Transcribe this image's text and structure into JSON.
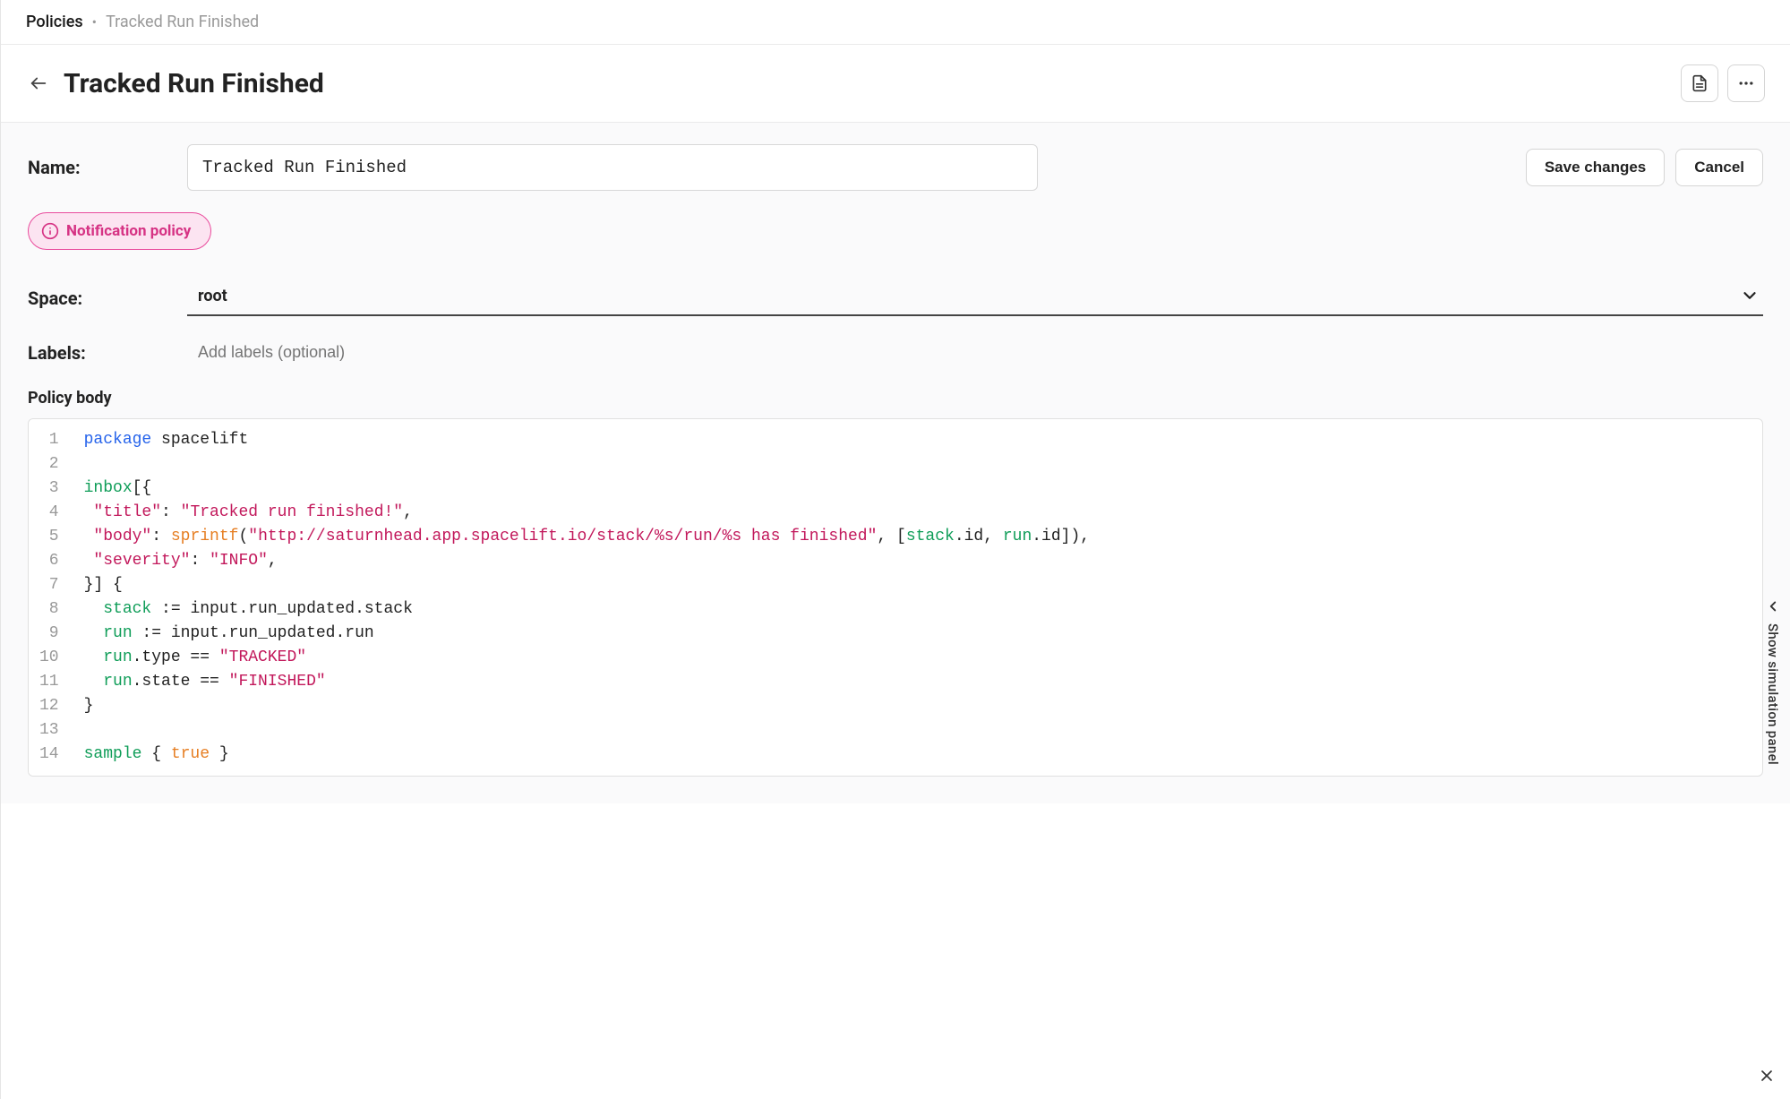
{
  "breadcrumb": {
    "root": "Policies",
    "separator": "•",
    "current": "Tracked Run Finished"
  },
  "header": {
    "title": "Tracked Run Finished"
  },
  "form": {
    "name_label": "Name:",
    "name_value": "Tracked Run Finished",
    "save_label": "Save changes",
    "cancel_label": "Cancel",
    "space_label": "Space:",
    "space_value": "root",
    "labels_label": "Labels:",
    "labels_placeholder": "Add labels (optional)"
  },
  "badge": {
    "text": "Notification policy"
  },
  "policy_body_title": "Policy body",
  "sim_panel_label": "Show simulation panel",
  "code": {
    "line_numbers": [
      "1",
      "2",
      "3",
      "4",
      "5",
      "6",
      "7",
      "8",
      "9",
      "10",
      "11",
      "12",
      "13",
      "14"
    ],
    "l1_kw": "package",
    "l1_rest": " spacelift",
    "l3_ident": "inbox",
    "l3_rest": "[{",
    "l4_key": "\"title\"",
    "l4_mid": ": ",
    "l4_val": "\"Tracked run finished!\"",
    "l4_end": ",",
    "l5_key": "\"body\"",
    "l5_a": ": ",
    "l5_fn": "sprintf",
    "l5_b": "(",
    "l5_str": "\"http://saturnhead.app.spacelift.io/stack/%s/run/%s has finished\"",
    "l5_c": ", [",
    "l5_stack": "stack",
    "l5_d": ".id, ",
    "l5_run": "run",
    "l5_e": ".id]),",
    "l6_key": "\"severity\"",
    "l6_a": ": ",
    "l6_val": "\"INFO\"",
    "l6_end": ",",
    "l7": "}] {",
    "l8_stack": "stack",
    "l8_rest": " := input.run_updated.stack",
    "l9_run": "run",
    "l9_rest": " := input.run_updated.run",
    "l10_run": "run",
    "l10_a": ".type == ",
    "l10_val": "\"TRACKED\"",
    "l11_run": "run",
    "l11_a": ".state == ",
    "l11_val": "\"FINISHED\"",
    "l12": "}",
    "l14_sample": "sample",
    "l14_a": " { ",
    "l14_true": "true",
    "l14_b": " }"
  }
}
